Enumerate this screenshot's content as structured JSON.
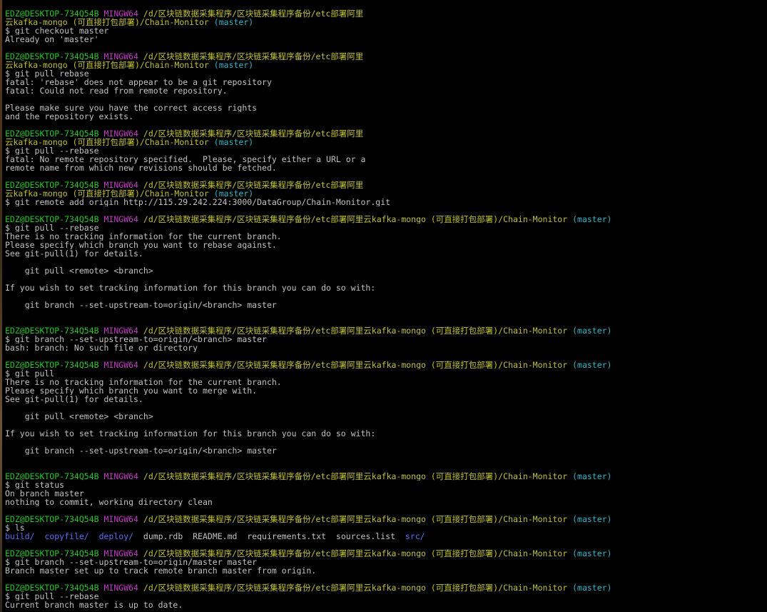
{
  "colors": {
    "background": "#000000",
    "text": "#c0c0c0",
    "user": "#23c723",
    "host": "#c23cc2",
    "path": "#c0c032",
    "branch": "#2fb5c8",
    "directory": "#5a6cf2"
  },
  "lines": [
    [
      {
        "t": "EDZ@DESKTOP-734Q54B",
        "c": "user"
      },
      {
        "t": " "
      },
      {
        "t": "MINGW64",
        "c": "host"
      },
      {
        "t": " "
      },
      {
        "t": "/d/区块链数据采集程序/区块链采集程序备份/etc部署阿里",
        "c": "path"
      }
    ],
    [
      {
        "t": "云kafka-mongo (可直接打包部署)/Chain-Monitor",
        "c": "path"
      },
      {
        "t": " "
      },
      {
        "t": "(master)",
        "c": "branch"
      }
    ],
    [
      {
        "t": "$ git checkout master"
      }
    ],
    [
      {
        "t": "Already on 'master'"
      }
    ],
    [],
    [
      {
        "t": "EDZ@DESKTOP-734Q54B",
        "c": "user"
      },
      {
        "t": " "
      },
      {
        "t": "MINGW64",
        "c": "host"
      },
      {
        "t": " "
      },
      {
        "t": "/d/区块链数据采集程序/区块链采集程序备份/etc部署阿里",
        "c": "path"
      }
    ],
    [
      {
        "t": "云kafka-mongo (可直接打包部署)/Chain-Monitor",
        "c": "path"
      },
      {
        "t": " "
      },
      {
        "t": "(master)",
        "c": "branch"
      }
    ],
    [
      {
        "t": "$ git pull rebase"
      }
    ],
    [
      {
        "t": "fatal: 'rebase' does not appear to be a git repository"
      }
    ],
    [
      {
        "t": "fatal: Could not read from remote repository."
      }
    ],
    [],
    [
      {
        "t": "Please make sure you have the correct access rights"
      }
    ],
    [
      {
        "t": "and the repository exists."
      }
    ],
    [],
    [
      {
        "t": "EDZ@DESKTOP-734Q54B",
        "c": "user"
      },
      {
        "t": " "
      },
      {
        "t": "MINGW64",
        "c": "host"
      },
      {
        "t": " "
      },
      {
        "t": "/d/区块链数据采集程序/区块链采集程序备份/etc部署阿里",
        "c": "path"
      }
    ],
    [
      {
        "t": "云kafka-mongo (可直接打包部署)/Chain-Monitor",
        "c": "path"
      },
      {
        "t": " "
      },
      {
        "t": "(master)",
        "c": "branch"
      }
    ],
    [
      {
        "t": "$ git pull --rebase"
      }
    ],
    [
      {
        "t": "fatal: No remote repository specified.  Please, specify either a URL or a"
      }
    ],
    [
      {
        "t": "remote name from which new revisions should be fetched."
      }
    ],
    [],
    [
      {
        "t": "EDZ@DESKTOP-734Q54B",
        "c": "user"
      },
      {
        "t": " "
      },
      {
        "t": "MINGW64",
        "c": "host"
      },
      {
        "t": " "
      },
      {
        "t": "/d/区块链数据采集程序/区块链采集程序备份/etc部署阿里",
        "c": "path"
      }
    ],
    [
      {
        "t": "云kafka-mongo (可直接打包部署)/Chain-Monitor",
        "c": "path"
      },
      {
        "t": " "
      },
      {
        "t": "(master)",
        "c": "branch"
      }
    ],
    [
      {
        "t": "$ git remote add origin http://115.29.242.224:3000/DataGroup/Chain-Monitor.git"
      }
    ],
    [],
    [
      {
        "t": "EDZ@DESKTOP-734Q54B",
        "c": "user"
      },
      {
        "t": " "
      },
      {
        "t": "MINGW64",
        "c": "host"
      },
      {
        "t": " "
      },
      {
        "t": "/d/区块链数据采集程序/区块链采集程序备份/etc部署阿里云kafka-mongo (可直接打包部署)/Chain-Monitor",
        "c": "path"
      },
      {
        "t": " "
      },
      {
        "t": "(master)",
        "c": "branch"
      }
    ],
    [
      {
        "t": "$ git pull --rebase"
      }
    ],
    [
      {
        "t": "There is no tracking information for the current branch."
      }
    ],
    [
      {
        "t": "Please specify which branch you want to rebase against."
      }
    ],
    [
      {
        "t": "See git-pull(1) for details."
      }
    ],
    [],
    [
      {
        "t": "    git pull <remote> <branch>"
      }
    ],
    [],
    [
      {
        "t": "If you wish to set tracking information for this branch you can do so with:"
      }
    ],
    [],
    [
      {
        "t": "    git branch --set-upstream-to=origin/<branch> master"
      }
    ],
    [],
    [],
    [
      {
        "t": "EDZ@DESKTOP-734Q54B",
        "c": "user"
      },
      {
        "t": " "
      },
      {
        "t": "MINGW64",
        "c": "host"
      },
      {
        "t": " "
      },
      {
        "t": "/d/区块链数据采集程序/区块链采集程序备份/etc部署阿里云kafka-mongo (可直接打包部署)/Chain-Monitor",
        "c": "path"
      },
      {
        "t": " "
      },
      {
        "t": "(master)",
        "c": "branch"
      }
    ],
    [
      {
        "t": "$ git branch --set-upstream-to=origin/<branch> master"
      }
    ],
    [
      {
        "t": "bash: branch: No such file or directory"
      }
    ],
    [],
    [
      {
        "t": "EDZ@DESKTOP-734Q54B",
        "c": "user"
      },
      {
        "t": " "
      },
      {
        "t": "MINGW64",
        "c": "host"
      },
      {
        "t": " "
      },
      {
        "t": "/d/区块链数据采集程序/区块链采集程序备份/etc部署阿里云kafka-mongo (可直接打包部署)/Chain-Monitor",
        "c": "path"
      },
      {
        "t": " "
      },
      {
        "t": "(master)",
        "c": "branch"
      }
    ],
    [
      {
        "t": "$ git pull"
      }
    ],
    [
      {
        "t": "There is no tracking information for the current branch."
      }
    ],
    [
      {
        "t": "Please specify which branch you want to merge with."
      }
    ],
    [
      {
        "t": "See git-pull(1) for details."
      }
    ],
    [],
    [
      {
        "t": "    git pull <remote> <branch>"
      }
    ],
    [],
    [
      {
        "t": "If you wish to set tracking information for this branch you can do so with:"
      }
    ],
    [],
    [
      {
        "t": "    git branch --set-upstream-to=origin/<branch> master"
      }
    ],
    [],
    [],
    [
      {
        "t": "EDZ@DESKTOP-734Q54B",
        "c": "user"
      },
      {
        "t": " "
      },
      {
        "t": "MINGW64",
        "c": "host"
      },
      {
        "t": " "
      },
      {
        "t": "/d/区块链数据采集程序/区块链采集程序备份/etc部署阿里云kafka-mongo (可直接打包部署)/Chain-Monitor",
        "c": "path"
      },
      {
        "t": " "
      },
      {
        "t": "(master)",
        "c": "branch"
      }
    ],
    [
      {
        "t": "$ git status"
      }
    ],
    [
      {
        "t": "On branch master"
      }
    ],
    [
      {
        "t": "nothing to commit, working directory clean"
      }
    ],
    [],
    [
      {
        "t": "EDZ@DESKTOP-734Q54B",
        "c": "user"
      },
      {
        "t": " "
      },
      {
        "t": "MINGW64",
        "c": "host"
      },
      {
        "t": " "
      },
      {
        "t": "/d/区块链数据采集程序/区块链采集程序备份/etc部署阿里云kafka-mongo (可直接打包部署)/Chain-Monitor",
        "c": "path"
      },
      {
        "t": " "
      },
      {
        "t": "(master)",
        "c": "branch"
      }
    ],
    [
      {
        "t": "$ ls"
      }
    ],
    [
      {
        "t": "build/",
        "c": "dir"
      },
      {
        "t": "  "
      },
      {
        "t": "copyfile/",
        "c": "dir"
      },
      {
        "t": "  "
      },
      {
        "t": "deploy/",
        "c": "dir"
      },
      {
        "t": "  dump.rdb  README.md  requirements.txt  sources.list  "
      },
      {
        "t": "src/",
        "c": "dir"
      }
    ],
    [],
    [
      {
        "t": "EDZ@DESKTOP-734Q54B",
        "c": "user"
      },
      {
        "t": " "
      },
      {
        "t": "MINGW64",
        "c": "host"
      },
      {
        "t": " "
      },
      {
        "t": "/d/区块链数据采集程序/区块链采集程序备份/etc部署阿里云kafka-mongo (可直接打包部署)/Chain-Monitor",
        "c": "path"
      },
      {
        "t": " "
      },
      {
        "t": "(master)",
        "c": "branch"
      }
    ],
    [
      {
        "t": "$ git branch --set-upstream-to=origin/master master"
      }
    ],
    [
      {
        "t": "Branch master set up to track remote branch master from origin."
      }
    ],
    [],
    [
      {
        "t": "EDZ@DESKTOP-734Q54B",
        "c": "user"
      },
      {
        "t": " "
      },
      {
        "t": "MINGW64",
        "c": "host"
      },
      {
        "t": " "
      },
      {
        "t": "/d/区块链数据采集程序/区块链采集程序备份/etc部署阿里云kafka-mongo (可直接打包部署)/Chain-Monitor",
        "c": "path"
      },
      {
        "t": " "
      },
      {
        "t": "(master)",
        "c": "branch"
      }
    ],
    [
      {
        "t": "$ git pull --rebase"
      }
    ],
    [
      {
        "t": "Current branch master is up to date."
      }
    ]
  ]
}
